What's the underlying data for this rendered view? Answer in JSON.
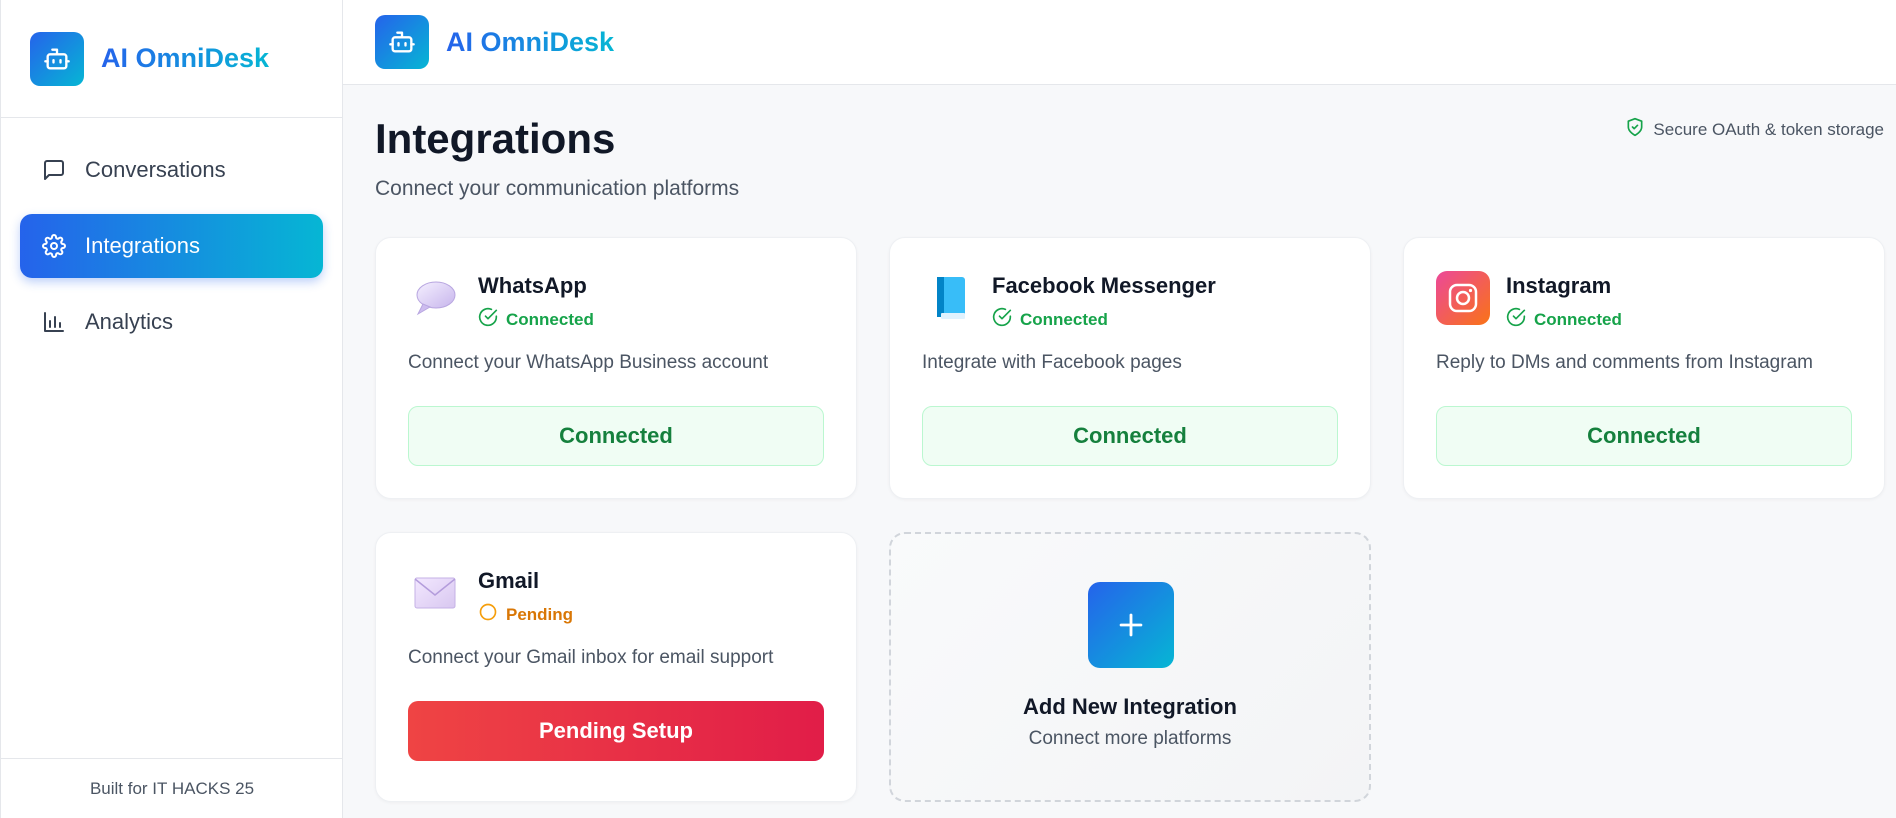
{
  "app": {
    "name": "AI OmniDesk"
  },
  "sidebar": {
    "items": [
      {
        "label": "Conversations",
        "icon": "message-square-icon",
        "active": false
      },
      {
        "label": "Integrations",
        "icon": "gear-icon",
        "active": true
      },
      {
        "label": "Analytics",
        "icon": "bar-chart-icon",
        "active": false
      }
    ],
    "footer": "Built for IT HACKS 25"
  },
  "page": {
    "title": "Integrations",
    "subtitle": "Connect your communication platforms",
    "secure_note": "Secure OAuth & token storage"
  },
  "integrations": [
    {
      "name": "WhatsApp",
      "icon": "speech-balloon-icon",
      "status": "Connected",
      "description": "Connect your WhatsApp Business account",
      "button": "Connected"
    },
    {
      "name": "Facebook Messenger",
      "icon": "blue-book-icon",
      "status": "Connected",
      "description": "Integrate with Facebook pages",
      "button": "Connected"
    },
    {
      "name": "Instagram",
      "icon": "instagram-icon",
      "status": "Connected",
      "description": "Reply to DMs and comments from Instagram",
      "button": "Connected"
    },
    {
      "name": "Gmail",
      "icon": "envelope-icon",
      "status": "Pending",
      "description": "Connect your Gmail inbox for email support",
      "button": "Pending Setup"
    }
  ],
  "add_integration": {
    "title": "Add New Integration",
    "subtitle": "Connect more platforms"
  },
  "colors": {
    "accent_start": "#2563eb",
    "accent_end": "#06b6d4",
    "connected": "#16a34a",
    "pending": "#d97706",
    "danger": "#ef4444"
  }
}
